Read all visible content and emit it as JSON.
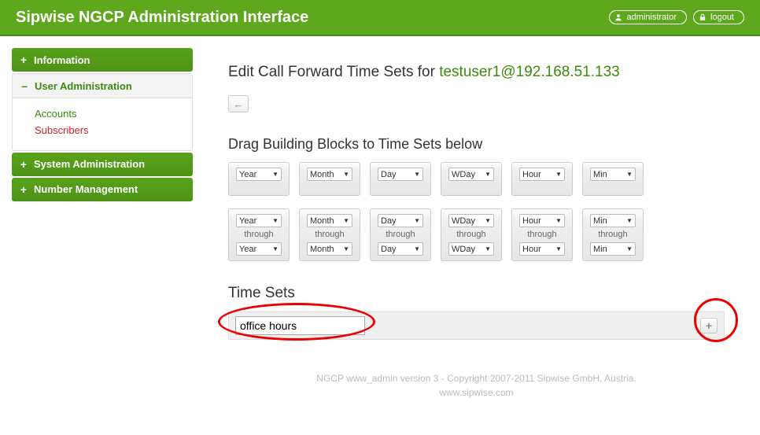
{
  "topbar": {
    "title": "Sipwise NGCP Administration Interface",
    "user_label": "administrator",
    "logout_label": "logout"
  },
  "sidebar": {
    "items": [
      {
        "label": "Information",
        "toggle": "+"
      },
      {
        "label": "User Administration",
        "toggle": "–"
      },
      {
        "label": "System Administration",
        "toggle": "+"
      },
      {
        "label": "Number Management",
        "toggle": "+"
      }
    ],
    "user_admin_sub": {
      "accounts": "Accounts",
      "subscribers": "Subscribers"
    }
  },
  "main": {
    "heading_prefix": "Edit Call Forward Time Sets for ",
    "heading_link": "testuser1@192.168.51.133",
    "blocks_heading": "Drag Building Blocks to Time Sets below",
    "block_labels": {
      "year": "Year",
      "month": "Month",
      "day": "Day",
      "wday": "WDay",
      "hour": "Hour",
      "min": "Min",
      "through": "through"
    },
    "timesets_heading": "Time Sets",
    "timeset_input_value": "office hours"
  },
  "footer": {
    "line1": "NGCP www_admin version 3 - Copyright 2007-2011 Sipwise GmbH, Austria.",
    "line2": "www.sipwise.com"
  }
}
